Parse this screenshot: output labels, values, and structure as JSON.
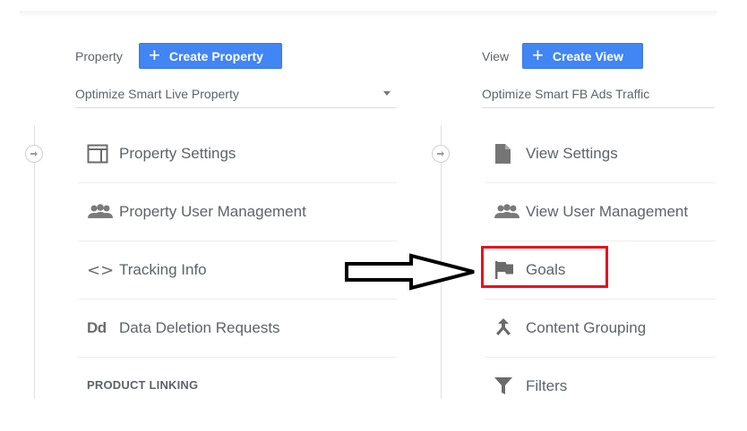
{
  "property": {
    "label": "Property",
    "create_button": "Create Property",
    "selected": "Optimize Smart Live Property",
    "menu": [
      {
        "label": "Property Settings",
        "icon": "property-layout-icon"
      },
      {
        "label": "Property User Management",
        "icon": "people-icon"
      },
      {
        "label": "Tracking Info",
        "icon": "code-icon",
        "glyph": "<>"
      },
      {
        "label": "Data Deletion Requests",
        "icon": "dd-icon",
        "glyph": "Dd"
      }
    ],
    "section_heading": "PRODUCT LINKING"
  },
  "view": {
    "label": "View",
    "create_button": "Create View",
    "selected": "Optimize Smart FB Ads Traffic",
    "menu": [
      {
        "label": "View Settings",
        "icon": "document-icon"
      },
      {
        "label": "View User Management",
        "icon": "people-icon"
      },
      {
        "label": "Goals",
        "icon": "flag-icon",
        "highlighted": true
      },
      {
        "label": "Content Grouping",
        "icon": "content-grouping-icon"
      },
      {
        "label": "Filters",
        "icon": "filter-icon"
      }
    ]
  },
  "colors": {
    "accent": "#4285f4",
    "highlight": "#e8111d",
    "text": "#5f6368"
  }
}
